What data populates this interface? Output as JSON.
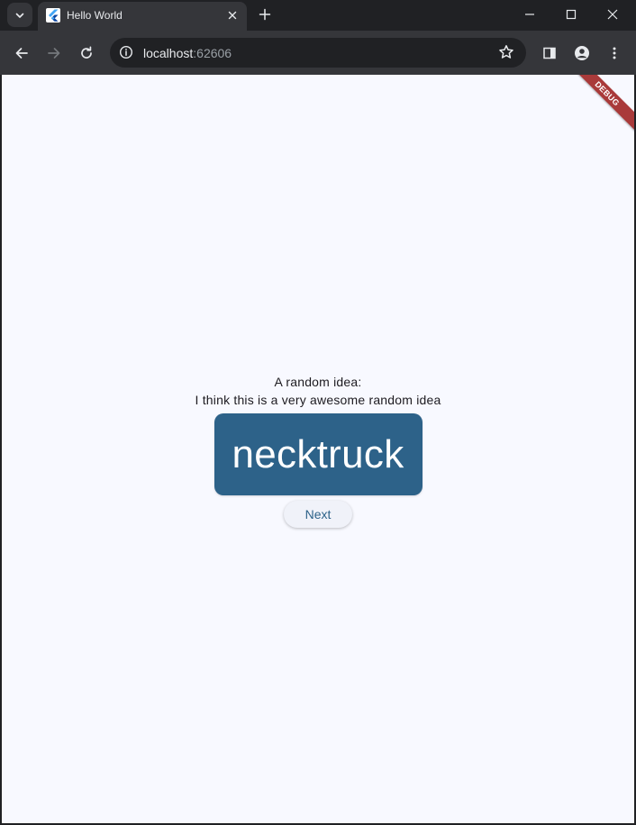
{
  "browser": {
    "tab_title": "Hello World",
    "url_host": "localhost",
    "url_port": ":62606",
    "colors": {
      "frame": "#202124",
      "toolbar": "#35363a",
      "page_bg": "#f8f9ff"
    },
    "icons": {
      "tab_search": "chevron-down-icon",
      "favicon": "flutter-icon",
      "tab_close": "close-icon",
      "new_tab": "plus-icon",
      "minimize": "minimize-icon",
      "maximize": "maximize-icon",
      "close_window": "close-icon",
      "back": "arrow-left-icon",
      "forward": "arrow-right-icon",
      "reload": "reload-icon",
      "site_info": "info-icon",
      "bookmark": "star-icon",
      "side_panel": "side-panel-icon",
      "profile": "person-icon",
      "menu": "more-vert-icon"
    }
  },
  "app": {
    "debug_banner": "DEBUG",
    "label": "A random idea:",
    "description": "I think this is a very awesome random idea",
    "word": "necktruck",
    "next_label": "Next",
    "colors": {
      "card": "#2d6289",
      "card_text": "#ffffff",
      "button_text": "#2d6289",
      "banner": "#a93a3a"
    }
  }
}
